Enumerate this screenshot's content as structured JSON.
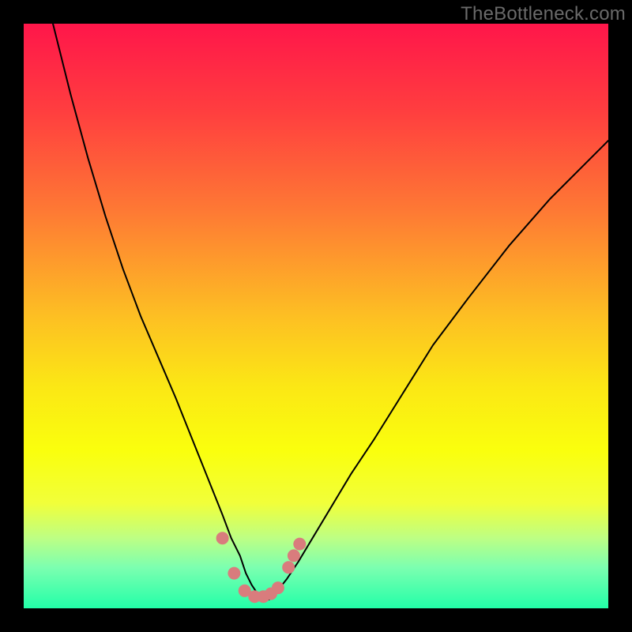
{
  "watermark": "TheBottleneck.com",
  "chart_data": {
    "type": "line",
    "title": "",
    "xlabel": "",
    "ylabel": "",
    "xlim": [
      0,
      100
    ],
    "ylim": [
      0,
      100
    ],
    "background_gradient": {
      "stops": [
        {
          "offset": 0.0,
          "color": "#ff164a"
        },
        {
          "offset": 0.15,
          "color": "#ff3e3f"
        },
        {
          "offset": 0.32,
          "color": "#fe7934"
        },
        {
          "offset": 0.5,
          "color": "#fdbf23"
        },
        {
          "offset": 0.62,
          "color": "#fbe715"
        },
        {
          "offset": 0.73,
          "color": "#faff0d"
        },
        {
          "offset": 0.82,
          "color": "#f1ff3a"
        },
        {
          "offset": 0.88,
          "color": "#bdff84"
        },
        {
          "offset": 0.93,
          "color": "#7cffb0"
        },
        {
          "offset": 1.0,
          "color": "#22ffa8"
        }
      ]
    },
    "series": [
      {
        "name": "bottleneck-curve",
        "stroke": "#000000",
        "stroke_width": 2,
        "x": [
          5,
          8,
          11,
          14,
          17,
          20,
          23,
          26,
          28,
          30,
          32,
          34,
          35.5,
          37,
          38,
          39,
          40,
          41,
          42,
          43,
          45,
          47,
          50,
          53,
          56,
          60,
          65,
          70,
          76,
          83,
          90,
          97,
          100
        ],
        "y": [
          100,
          88,
          77,
          67,
          58,
          50,
          43,
          36,
          31,
          26,
          21,
          16,
          12,
          9,
          6,
          4,
          2.5,
          1.5,
          1.5,
          2.5,
          5,
          8,
          13,
          18,
          23,
          29,
          37,
          45,
          53,
          62,
          70,
          77,
          80
        ]
      }
    ],
    "markers": {
      "name": "flat-region-dots",
      "color": "#d97c7d",
      "radius": 8,
      "x": [
        34,
        36,
        37.8,
        39.5,
        41,
        42.3,
        43.5,
        45.3,
        46.2,
        47.2
      ],
      "y": [
        12,
        6,
        3,
        2,
        2,
        2.5,
        3.5,
        7,
        9,
        11
      ]
    }
  }
}
